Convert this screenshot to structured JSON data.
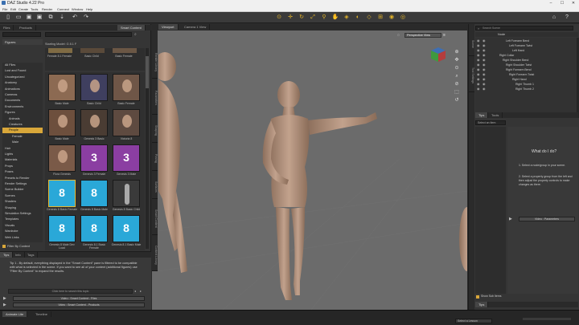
{
  "window": {
    "title": "DAZ Studio 4.22 Pro"
  },
  "menu": [
    "File",
    "Edit",
    "Create",
    "Tools",
    "Render",
    "Connect",
    "Window",
    "Help"
  ],
  "colors": {
    "accent": "#d9a73a",
    "panel": "#353535",
    "viewport": "#6b6b6b"
  },
  "left_panel": {
    "tabs": [
      "Files",
      "Products",
      "Smart Content"
    ],
    "tabs_active": "Smart Content",
    "filter_label": "Starting Model: G 8.1 F",
    "category_header": "Figures",
    "categories": [
      {
        "label": "All Files",
        "level": 0
      },
      {
        "label": "Lost and Found",
        "level": 0
      },
      {
        "label": "Uncategorized",
        "level": 0
      },
      {
        "label": "Anatomy",
        "level": 0
      },
      {
        "label": "Animations",
        "level": 0
      },
      {
        "label": "Cameras",
        "level": 0
      },
      {
        "label": "Documents",
        "level": 0
      },
      {
        "label": "Environments",
        "level": 0
      },
      {
        "label": "Figures",
        "level": 0
      },
      {
        "label": "Animals",
        "level": 1
      },
      {
        "label": "Creatures",
        "level": 1
      },
      {
        "label": "People",
        "level": 1,
        "selected": true
      },
      {
        "label": "Female",
        "level": 2
      },
      {
        "label": "Male",
        "level": 2
      },
      {
        "label": "Hair",
        "level": 0
      },
      {
        "label": "Lights",
        "level": 0
      },
      {
        "label": "Materials",
        "level": 0
      },
      {
        "label": "Props",
        "level": 0
      },
      {
        "label": "Poses",
        "level": 0
      },
      {
        "label": "Presets to Render",
        "level": 0
      },
      {
        "label": "Render Settings",
        "level": 0
      },
      {
        "label": "Scene Builder",
        "level": 0
      },
      {
        "label": "Scenes",
        "level": 0
      },
      {
        "label": "Shaders",
        "level": 0
      },
      {
        "label": "Shaping",
        "level": 0
      },
      {
        "label": "Simulation Settings",
        "level": 0
      },
      {
        "label": "Templates",
        "level": 0
      },
      {
        "label": "Visuals",
        "level": 0
      },
      {
        "label": "Wardrobe",
        "level": 0
      },
      {
        "label": "Web Links",
        "level": 0
      }
    ],
    "bottom_checkbox": "Filter By Context",
    "tiles": [
      {
        "label": "Basic Male",
        "kind": "photo-m"
      },
      {
        "label": "Basic Child",
        "kind": "photo-c"
      },
      {
        "label": "Basic Female",
        "kind": "photo-f"
      },
      {
        "label": "Basic Male",
        "kind": "photo-m2"
      },
      {
        "label": "Genesis 3 Basic",
        "kind": "photo-g"
      },
      {
        "label": "Victoria 8",
        "kind": "photo-v"
      },
      {
        "label": "Flora Genesis",
        "kind": "photo-fl"
      },
      {
        "label": "Genesis 3 Female",
        "kind": "g3"
      },
      {
        "label": "Genesis 3 Male",
        "kind": "g3"
      },
      {
        "label": "Genesis 8 Basic Female",
        "kind": "g8",
        "selected": true
      },
      {
        "label": "Genesis 8 Basic Male",
        "kind": "g8"
      },
      {
        "label": "Genesis 8 Basic Child",
        "kind": "g8-fig"
      },
      {
        "label": "Genesis 8 Male Dev Load",
        "kind": "g8"
      },
      {
        "label": "Genesis 8.1 Basic Female",
        "kind": "g8"
      },
      {
        "label": "Genesis 8.1 Basic Male",
        "kind": "g8"
      }
    ],
    "tips_tabs": [
      "Tips",
      "Info",
      "Tags"
    ],
    "tip_text": "Tip 1 - By default, everything displayed in the \"Smart Content\" pane is filtered to be compatible with what is selected in the scene. If you want to see all of your content (additional figures) use \"Filter By Context\" to expand the results.",
    "search_placeholder": "Click here to search this topic",
    "video_btn_1": "Video : Smart Content - Files",
    "video_btn_2": "Video : Smart Content - Products",
    "tile_header": "Female 8.1 Female"
  },
  "viewport": {
    "tabs": [
      "Viewport",
      "Camera 1 View"
    ],
    "camera_label": "Perspective View",
    "side_tabs": [
      "Render Library",
      "Parameters",
      "Shaping",
      "Posing",
      "Surfaces",
      "Smart Content",
      "Content Library"
    ]
  },
  "right_panel": {
    "tabs": [
      "Scene",
      "Tool Settings"
    ],
    "search_placeholder": "Search Scene",
    "tree_header": "Node",
    "tree": [
      {
        "label": "Left Forearm Bend",
        "indent": 5
      },
      {
        "label": "Left Forearm Twist",
        "indent": 6
      },
      {
        "label": "Left Hand",
        "indent": 7
      },
      {
        "label": "Right Collar",
        "indent": 3
      },
      {
        "label": "Right Shoulder Bend",
        "indent": 4
      },
      {
        "label": "Right Shoulder Twist",
        "indent": 5
      },
      {
        "label": "Right Forearm Bend",
        "indent": 5
      },
      {
        "label": "Right Forearm Twist",
        "indent": 6
      },
      {
        "label": "Right Hand",
        "indent": 7
      },
      {
        "label": "Right Thumb 1",
        "indent": 8
      },
      {
        "label": "Right Thumb 2",
        "indent": 8
      }
    ],
    "lower_tabs": [
      "Tips",
      "Tools"
    ],
    "select_placeholder": "Select an Item",
    "help_title": "What do I do?",
    "help_step_1": "1. Select a node/group in your scene.",
    "help_step_2": "2. Select a property group from the left and then adjust the property controls to make changes as there.",
    "help_video": "Video : Parameters",
    "show_sub_items": "Show Sub Items"
  },
  "status": {
    "tabs": [
      "Animate Lite",
      "Timeline"
    ],
    "right_field": "Select a Lesson"
  }
}
